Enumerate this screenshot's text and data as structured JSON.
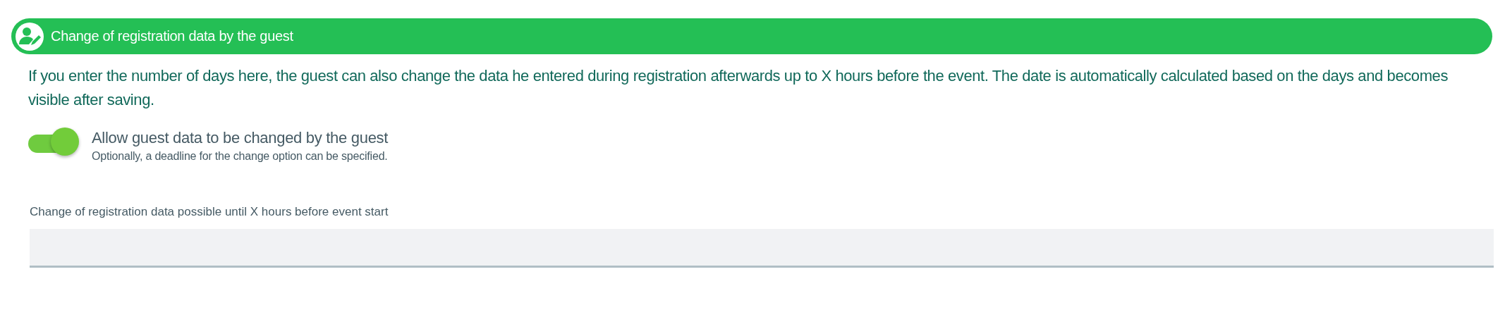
{
  "section": {
    "title": "Change of registration data by the guest"
  },
  "description": "If you enter the number of days here, the guest can also change the data he entered during registration afterwards up to X hours before the event. The date is automatically calculated based on the days and becomes visible after saving.",
  "toggle": {
    "label": "Allow guest data to be changed by the guest",
    "hint": "Optionally, a deadline for the change option can be specified.",
    "on": true
  },
  "field": {
    "label": "Change of registration data possible until X hours before event start"
  }
}
